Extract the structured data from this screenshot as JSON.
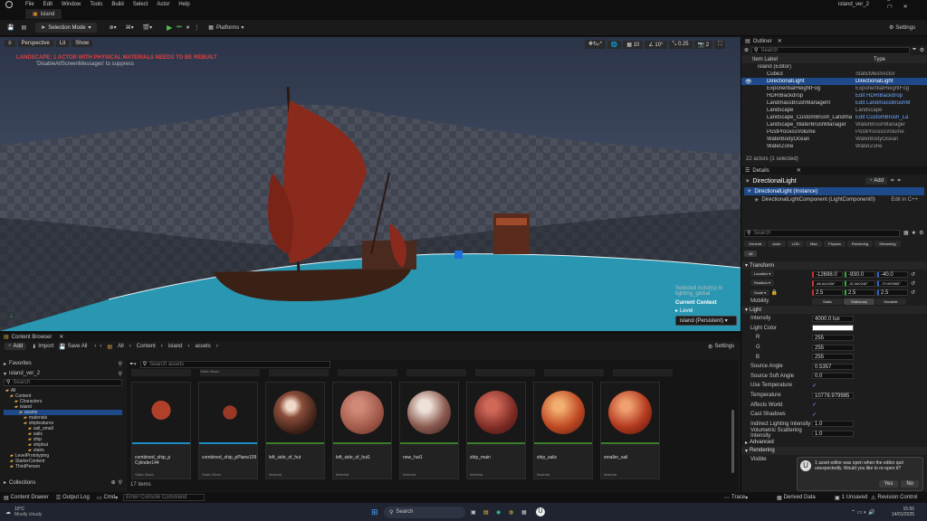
{
  "menu": {
    "items": [
      "File",
      "Edit",
      "Window",
      "Tools",
      "Build",
      "Select",
      "Actor",
      "Help"
    ],
    "project": "island_ver_2"
  },
  "tab": {
    "label": "island"
  },
  "toolbar": {
    "selection_mode": "Selection Mode",
    "platforms": "Platforms",
    "settings": "Settings"
  },
  "viewport": {
    "perspective": "Perspective",
    "lit": "Lit",
    "show": "Show",
    "warning": "LANDSCAPE: 1 ACTOR WITH PHYSICAL MATERIALS NEEDS TO BE REBUILT",
    "warning_sub": "'DisableAllScreenMessages' to suppress",
    "snap_grid": "10",
    "snap_angle": "10°",
    "snap_scale": "0.25",
    "cam_speed": "2",
    "selected_label": "Selected Actor(s) in",
    "selected_value": "lighting_global",
    "current_context": "Current Context",
    "level_label": "Level",
    "level_value": "island (Persistent)"
  },
  "outliner": {
    "title": "Outliner",
    "search_placeholder": "Search",
    "col_label": "Item Label",
    "col_type": "Type",
    "rows": [
      {
        "name": "island (Editor)",
        "type": ""
      },
      {
        "name": "Cube3",
        "type": "StaticMeshActor"
      },
      {
        "name": "DirectionalLight",
        "type": "DirectionalLight"
      },
      {
        "name": "ExponentialHeightFog",
        "type": "ExponentialHeightFog"
      },
      {
        "name": "HDRIBackdrop",
        "type": "Edit HDRIBackdrop"
      },
      {
        "name": "LandmassBrushManager0",
        "type": "Edit LandmassBrushM"
      },
      {
        "name": "Landscape",
        "type": "Landscape"
      },
      {
        "name": "Landscape_CustomBrush_Landmass_C",
        "type": "Edit CustomBrush_La"
      },
      {
        "name": "Landscape_WaterBrushManager",
        "type": "WaterBrushManager"
      },
      {
        "name": "PostProcessVolume",
        "type": "PostProcessVolume"
      },
      {
        "name": "WaterBodyOcean",
        "type": "WaterBodyOcean"
      },
      {
        "name": "WaterZone",
        "type": "WaterZone"
      }
    ],
    "footer": "22 actors (1 selected)"
  },
  "details": {
    "title": "Details",
    "actor": "DirectionalLight",
    "add": "Add",
    "instance": "DirectionalLight (Instance)",
    "component": "DirectionalLightComponent (LightComponent0)",
    "edit_cpp": "Edit in C++",
    "search_placeholder": "Search",
    "tabs": [
      "General",
      "Actor",
      "LOD",
      "Misc",
      "Physics",
      "Rendering",
      "Streaming",
      "All"
    ],
    "transform": "Transform",
    "location": "Location",
    "loc": [
      "-12698.0",
      "-930.0",
      "-40.0"
    ],
    "rotation": "Rotation",
    "rot": [
      "-86.644336°",
      "-32.060246°",
      "-79.999985°"
    ],
    "scale": "Scale",
    "scl": [
      "2.5",
      "2.5",
      "2.5"
    ],
    "mobility": "Mobility",
    "mob": [
      "Static",
      "Stationary",
      "Movable"
    ],
    "light": "Light",
    "props": [
      {
        "k": "Intensity",
        "v": "4000.0 lux"
      },
      {
        "k": "Light Color",
        "v": ""
      },
      {
        "k": "R",
        "v": "255"
      },
      {
        "k": "G",
        "v": "255"
      },
      {
        "k": "B",
        "v": "255"
      },
      {
        "k": "Source Angle",
        "v": "0.5357"
      },
      {
        "k": "Source Soft Angle",
        "v": "0.0"
      },
      {
        "k": "Use Temperature",
        "v": "✓"
      },
      {
        "k": "Temperature",
        "v": "10778.979985"
      },
      {
        "k": "Affects World",
        "v": "✓"
      },
      {
        "k": "Cast Shadows",
        "v": "✓"
      },
      {
        "k": "Indirect Lighting Intensity",
        "v": "1.0"
      },
      {
        "k": "Volumetric Scattering Intensity",
        "v": "1.0"
      }
    ],
    "advanced": "Advanced",
    "rendering": "Rendering",
    "visible": "Visible"
  },
  "toast": {
    "text": "1 asset editor was open when the editor quit unexpectedly. Would you like to re-open it?",
    "yes": "Yes",
    "no": "No"
  },
  "content_browser": {
    "title": "Content Browser",
    "add": "Add",
    "import": "Import",
    "save_all": "Save All",
    "crumbs": [
      "All",
      "Content",
      "island",
      "assets"
    ],
    "settings": "Settings",
    "favorites": "Favorites",
    "project": "island_ver_2",
    "search_placeholder": "Search assets",
    "search_folder": "Search",
    "tree": [
      "All",
      "Content",
      "Characters",
      "island",
      "assets",
      "materials",
      "shipteatures",
      "sail_small",
      "sails",
      "ship",
      "shipbut",
      "stairs",
      "LevelPrototyping",
      "StarterContent",
      "ThirdPerson"
    ],
    "collections": "Collections",
    "count": "17 items",
    "top_type": "Static Mesh",
    "assets": [
      {
        "name": "combined_ship_p Cylinder144",
        "type": "Static Mesh",
        "color": "#1b8ec7"
      },
      {
        "name": "combined_ship_pPlane109",
        "type": "Static Mesh",
        "color": "#1b8ec7"
      },
      {
        "name": "left_side_of_hut",
        "type": "Material",
        "color": "#3a7d2c"
      },
      {
        "name": "left_side_of_hut1",
        "type": "Material",
        "color": "#3a7d2c"
      },
      {
        "name": "new_hut1",
        "type": "Material",
        "color": "#3a7d2c"
      },
      {
        "name": "ship_main",
        "type": "Material",
        "color": "#3a7d2c"
      },
      {
        "name": "ship_sails",
        "type": "Material",
        "color": "#3a7d2c"
      },
      {
        "name": "smaller_sail",
        "type": "Material",
        "color": "#3a7d2c"
      }
    ]
  },
  "statusbar": {
    "drawer": "Content Drawer",
    "output": "Output Log",
    "cmd": "Cmd",
    "console_placeholder": "Enter Console Command",
    "trace": "Trace",
    "derived": "Derived Data",
    "unsaved": "1 Unsaved",
    "revision": "Revision Control"
  },
  "taskbar": {
    "temp": "10°C",
    "weather": "Mostly cloudy",
    "search": "Search",
    "time": "15:55",
    "date": "14/01/2025"
  }
}
